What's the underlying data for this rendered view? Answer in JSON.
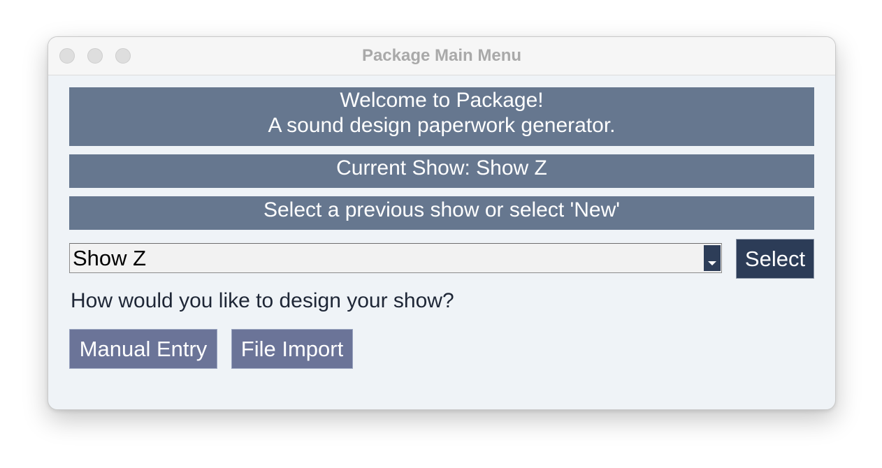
{
  "window": {
    "title": "Package Main Menu"
  },
  "banners": {
    "welcome_line1": "Welcome to Package!",
    "welcome_line2": "A sound design paperwork generator.",
    "current_show": "Current Show: Show Z",
    "select_prompt": "Select a previous show or select 'New'"
  },
  "show_selector": {
    "selected_value": "Show Z",
    "select_label": "Select"
  },
  "design": {
    "question": "How would you like to design your show?",
    "manual_label": "Manual Entry",
    "import_label": "File Import"
  },
  "colors": {
    "banner": "#66778f",
    "dark_button": "#2c3c57",
    "action_button": "#6b7498",
    "window_bg": "#eff3f7"
  },
  "icons": {
    "dropdown": "chevron-down-icon"
  }
}
